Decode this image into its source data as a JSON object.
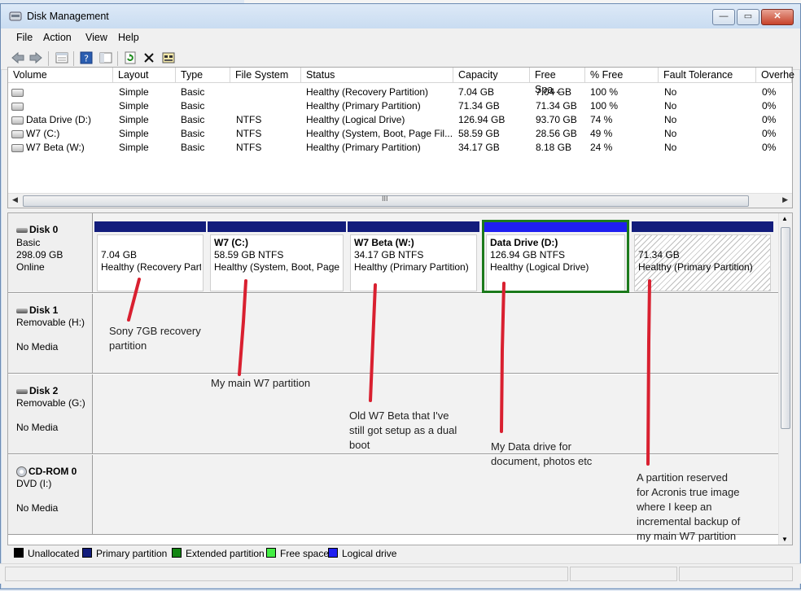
{
  "window": {
    "title": "Disk Management"
  },
  "window_buttons": {
    "minimize": "—",
    "maximize": "▭",
    "close": "✕"
  },
  "menu": [
    {
      "label": "File"
    },
    {
      "label": "Action"
    },
    {
      "label": "View"
    },
    {
      "label": "Help"
    }
  ],
  "toolbar_icons": [
    "back-arrow-icon",
    "forward-arrow-icon",
    "properties-list-icon",
    "help-icon",
    "console-view-icon",
    "refresh-icon",
    "delete-icon",
    "properties-icon"
  ],
  "volume_table": {
    "columns": [
      "Volume",
      "Layout",
      "Type",
      "File System",
      "Status",
      "Capacity",
      "Free Spa...",
      "% Free",
      "Fault Tolerance",
      "Overhe"
    ],
    "rows": [
      {
        "volume": "",
        "layout": "Simple",
        "type": "Basic",
        "fs": "",
        "status": "Healthy (Recovery Partition)",
        "capacity": "7.04 GB",
        "free": "7.04 GB",
        "pct": "100 %",
        "fault": "No",
        "overhead": "0%"
      },
      {
        "volume": "",
        "layout": "Simple",
        "type": "Basic",
        "fs": "",
        "status": "Healthy (Primary Partition)",
        "capacity": "71.34 GB",
        "free": "71.34 GB",
        "pct": "100 %",
        "fault": "No",
        "overhead": "0%"
      },
      {
        "volume": "Data Drive (D:)",
        "layout": "Simple",
        "type": "Basic",
        "fs": "NTFS",
        "status": "Healthy (Logical Drive)",
        "capacity": "126.94 GB",
        "free": "93.70 GB",
        "pct": "74 %",
        "fault": "No",
        "overhead": "0%"
      },
      {
        "volume": "W7 (C:)",
        "layout": "Simple",
        "type": "Basic",
        "fs": "NTFS",
        "status": "Healthy (System, Boot, Page Fil...",
        "capacity": "58.59 GB",
        "free": "28.56 GB",
        "pct": "49 %",
        "fault": "No",
        "overhead": "0%"
      },
      {
        "volume": "W7 Beta (W:)",
        "layout": "Simple",
        "type": "Basic",
        "fs": "NTFS",
        "status": "Healthy (Primary Partition)",
        "capacity": "34.17 GB",
        "free": "8.18 GB",
        "pct": "24 %",
        "fault": "No",
        "overhead": "0%"
      }
    ],
    "scroll_grip": "III"
  },
  "disks": [
    {
      "name": "Disk 0",
      "lines": [
        "Basic",
        "298.09 GB",
        "Online"
      ]
    },
    {
      "name": "Disk 1",
      "lines": [
        "Removable (H:)",
        "",
        "No Media"
      ]
    },
    {
      "name": "Disk 2",
      "lines": [
        "Removable (G:)",
        "",
        "No Media"
      ]
    },
    {
      "name": "CD-ROM 0",
      "lines": [
        "DVD (I:)",
        "",
        "No Media"
      ]
    }
  ],
  "partitions": [
    {
      "title": "",
      "line1": "7.04 GB",
      "line2": "Healthy (Recovery Parti"
    },
    {
      "title": "W7  (C:)",
      "line1": "58.59 GB NTFS",
      "line2": "Healthy (System, Boot, Page F"
    },
    {
      "title": "W7 Beta  (W:)",
      "line1": "34.17 GB NTFS",
      "line2": "Healthy (Primary Partition)"
    },
    {
      "title": "Data Drive  (D:)",
      "line1": "126.94 GB NTFS",
      "line2": "Healthy (Logical Drive)"
    },
    {
      "title": "",
      "line1": "71.34 GB",
      "line2": "Healthy (Primary Partition)"
    }
  ],
  "legend": [
    {
      "label": "Unallocated",
      "color": "#000000"
    },
    {
      "label": "Primary partition",
      "color": "#131d7c"
    },
    {
      "label": "Extended partition",
      "color": "#138513"
    },
    {
      "label": "Free space",
      "color": "#44ee44"
    },
    {
      "label": "Logical drive",
      "color": "#1f1ff0"
    }
  ],
  "annotations": [
    {
      "lines": [
        "Sony 7GB recovery",
        "partition"
      ]
    },
    {
      "lines": [
        "My main W7 partition"
      ]
    },
    {
      "lines": [
        "Old W7 Beta that I've",
        "still got setup as a dual",
        "boot"
      ]
    },
    {
      "lines": [
        "My Data drive for",
        "document, photos etc"
      ]
    },
    {
      "lines": [
        "A partition reserved",
        "for Acronis true image",
        "where I keep an",
        "incremental backup of",
        "my main W7 partition"
      ]
    }
  ],
  "colors": {
    "annotation_line": "#d92030",
    "selection_frame": "#1c7a1c"
  }
}
